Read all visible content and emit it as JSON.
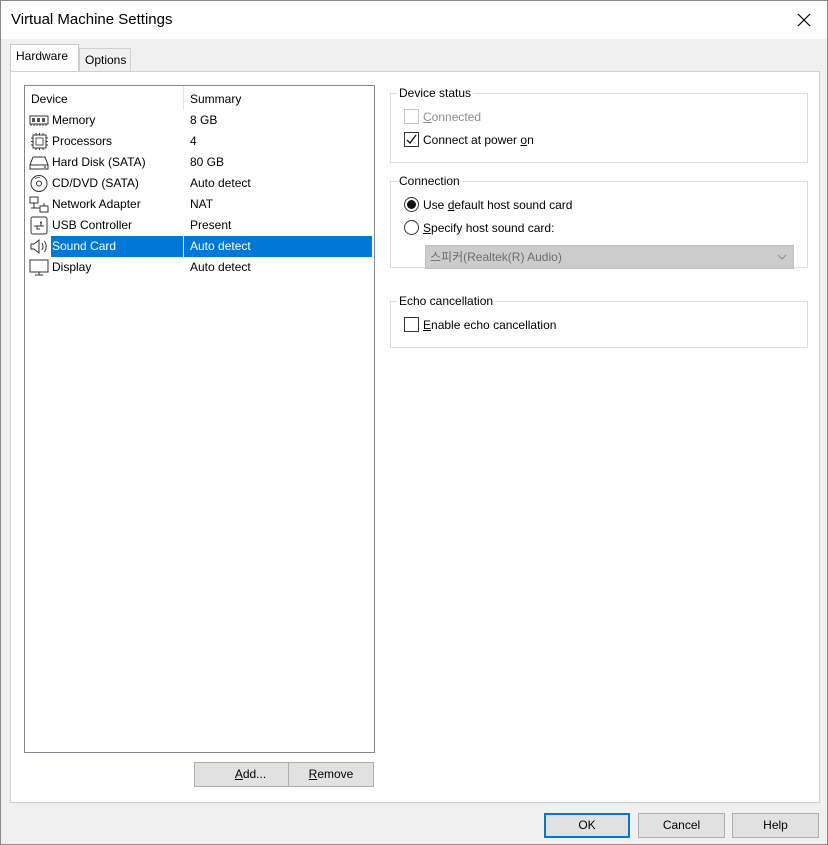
{
  "window": {
    "title": "Virtual Machine Settings"
  },
  "tabs": [
    {
      "label": "Hardware",
      "active": true
    },
    {
      "label": "Options",
      "active": false
    }
  ],
  "device_list": {
    "columns": {
      "device": "Device",
      "summary": "Summary"
    },
    "rows": [
      {
        "name": "Memory",
        "summary": "8 GB",
        "icon": "memory-icon"
      },
      {
        "name": "Processors",
        "summary": "4",
        "icon": "processor-icon"
      },
      {
        "name": "Hard Disk (SATA)",
        "summary": "80 GB",
        "icon": "hard-disk-icon"
      },
      {
        "name": "CD/DVD (SATA)",
        "summary": "Auto detect",
        "icon": "cd-dvd-icon"
      },
      {
        "name": "Network Adapter",
        "summary": "NAT",
        "icon": "network-adapter-icon"
      },
      {
        "name": "USB Controller",
        "summary": "Present",
        "icon": "usb-icon"
      },
      {
        "name": "Sound Card",
        "summary": "Auto detect",
        "icon": "speaker-icon",
        "selected": true
      },
      {
        "name": "Display",
        "summary": "Auto detect",
        "icon": "display-icon"
      }
    ],
    "selection_color": "#0078d7"
  },
  "list_buttons": {
    "add": {
      "pre": "",
      "ul": "A",
      "post": "dd..."
    },
    "remove": {
      "pre": "",
      "ul": "R",
      "post": "emove"
    }
  },
  "device_status": {
    "label": "Device status",
    "connected": {
      "pre": "",
      "ul": "C",
      "post": "onnected",
      "checked": false,
      "disabled": true
    },
    "connect_power": {
      "pre": "Connect at power ",
      "ul": "o",
      "post": "n",
      "checked": true
    }
  },
  "connection": {
    "label": "Connection",
    "use_default": {
      "pre": "Use ",
      "ul": "d",
      "post": "efault host sound card",
      "selected": true
    },
    "specify": {
      "pre": "",
      "ul": "S",
      "post": "pecify host sound card:",
      "selected": false
    },
    "dropdown_value": "스피커(Realtek(R) Audio)"
  },
  "echo": {
    "label": "Echo cancellation",
    "enable": {
      "pre": "",
      "ul": "E",
      "post": "nable echo cancellation",
      "checked": false
    }
  },
  "footer": {
    "ok": "OK",
    "cancel": "Cancel",
    "help": "Help"
  }
}
